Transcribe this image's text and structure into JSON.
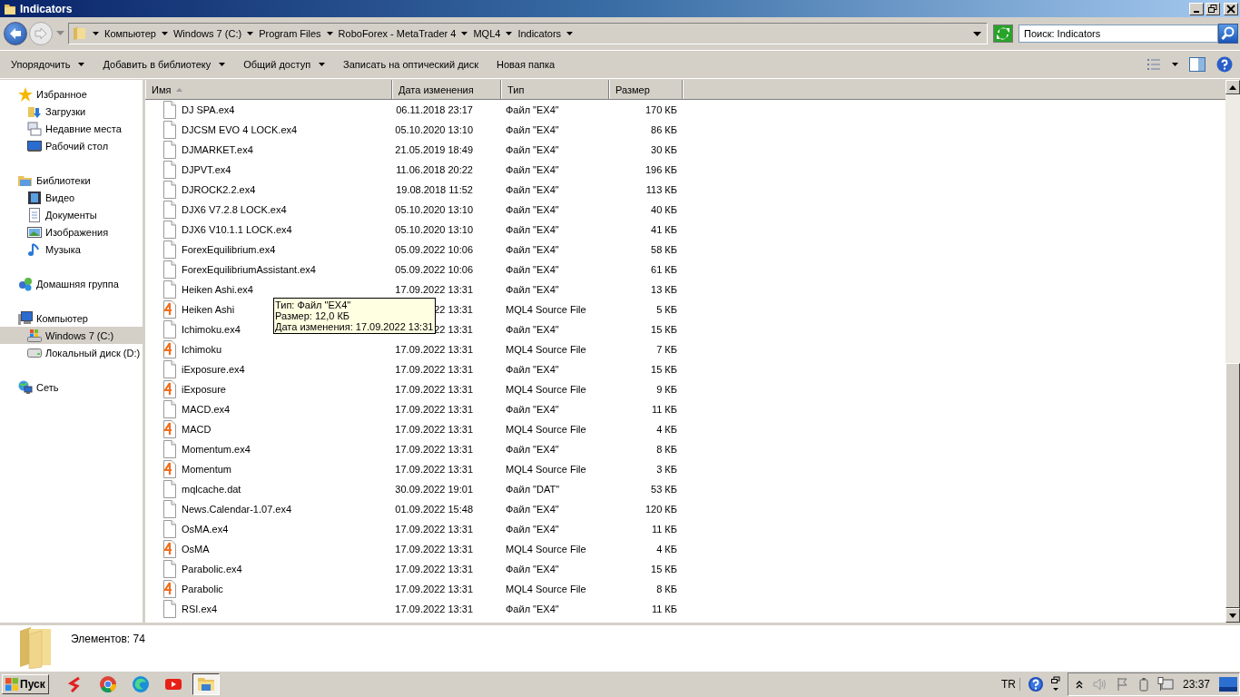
{
  "window": {
    "title": "Indicators"
  },
  "address": {
    "crumbs": [
      "Компьютер",
      "Windows 7 (C:)",
      "Program Files",
      "RoboForex - MetaTrader 4",
      "MQL4",
      "Indicators"
    ],
    "search_placeholder": "Поиск: Indicators"
  },
  "toolbar": [
    {
      "label": "Упорядочить",
      "dropdown": true
    },
    {
      "label": "Добавить в библиотеку",
      "dropdown": true
    },
    {
      "label": "Общий доступ",
      "dropdown": true
    },
    {
      "label": "Записать на оптический диск",
      "dropdown": false
    },
    {
      "label": "Новая папка",
      "dropdown": false
    }
  ],
  "sidebar": [
    {
      "label": "Избранное",
      "selected": false,
      "children": [
        {
          "label": "Загрузки",
          "selected": false
        },
        {
          "label": "Недавние места",
          "selected": false
        },
        {
          "label": "Рабочий стол",
          "selected": false
        }
      ]
    },
    {
      "label": "Библиотеки",
      "selected": false,
      "children": [
        {
          "label": "Видео",
          "selected": false
        },
        {
          "label": "Документы",
          "selected": false
        },
        {
          "label": "Изображения",
          "selected": false
        },
        {
          "label": "Музыка",
          "selected": false
        }
      ]
    },
    {
      "label": "Домашняя группа",
      "selected": false
    },
    {
      "label": "Компьютер",
      "selected": false,
      "children": [
        {
          "label": "Windows 7 (C:)",
          "selected": true
        },
        {
          "label": "Локальный диск (D:)",
          "selected": false
        }
      ]
    },
    {
      "label": "Сеть",
      "selected": false
    }
  ],
  "table": {
    "columns": [
      {
        "label": "Имя",
        "sorted": true
      },
      {
        "label": "Дата изменения",
        "sorted": false
      },
      {
        "label": "Тип",
        "sorted": false
      },
      {
        "label": "Размер",
        "sorted": false
      }
    ],
    "rows": [
      {
        "name": "DJ SPA.ex4",
        "date": "06.11.2018 23:17",
        "type": "Файл \"EX4\"",
        "size": "170 КБ",
        "kind": "blank"
      },
      {
        "name": "DJCSM EVO 4 LOCK.ex4",
        "date": "05.10.2020 13:10",
        "type": "Файл \"EX4\"",
        "size": "86 КБ",
        "kind": "blank"
      },
      {
        "name": "DJMARKET.ex4",
        "date": "21.05.2019 18:49",
        "type": "Файл \"EX4\"",
        "size": "30 КБ",
        "kind": "blank"
      },
      {
        "name": "DJPVT.ex4",
        "date": "11.06.2018 20:22",
        "type": "Файл \"EX4\"",
        "size": "196 КБ",
        "kind": "blank"
      },
      {
        "name": "DJROCK2.2.ex4",
        "date": "19.08.2018 11:52",
        "type": "Файл \"EX4\"",
        "size": "113 КБ",
        "kind": "blank"
      },
      {
        "name": "DJX6 V7.2.8 LOCK.ex4",
        "date": "05.10.2020 13:10",
        "type": "Файл \"EX4\"",
        "size": "40 КБ",
        "kind": "blank"
      },
      {
        "name": "DJX6 V10.1.1 LOCK.ex4",
        "date": "05.10.2020 13:10",
        "type": "Файл \"EX4\"",
        "size": "41 КБ",
        "kind": "blank"
      },
      {
        "name": "ForexEquilibrium.ex4",
        "date": "05.09.2022 10:06",
        "type": "Файл \"EX4\"",
        "size": "58 КБ",
        "kind": "blank"
      },
      {
        "name": "ForexEquilibriumAssistant.ex4",
        "date": "05.09.2022 10:06",
        "type": "Файл \"EX4\"",
        "size": "61 КБ",
        "kind": "blank"
      },
      {
        "name": "Heiken Ashi.ex4",
        "date": "17.09.2022 13:31",
        "type": "Файл \"EX4\"",
        "size": "13 КБ",
        "kind": "blank"
      },
      {
        "name": "Heiken Ashi",
        "date": "22 13:31",
        "type": "MQL4 Source File",
        "size": "5 КБ",
        "kind": "mql4"
      },
      {
        "name": "Ichimoku.ex4",
        "date": "22 13:31",
        "type": "Файл \"EX4\"",
        "size": "15 КБ",
        "kind": "blank"
      },
      {
        "name": "Ichimoku",
        "date": "17.09.2022 13:31",
        "type": "MQL4 Source File",
        "size": "7 КБ",
        "kind": "mql4"
      },
      {
        "name": "iExposure.ex4",
        "date": "17.09.2022 13:31",
        "type": "Файл \"EX4\"",
        "size": "15 КБ",
        "kind": "blank"
      },
      {
        "name": "iExposure",
        "date": "17.09.2022 13:31",
        "type": "MQL4 Source File",
        "size": "9 КБ",
        "kind": "mql4"
      },
      {
        "name": "MACD.ex4",
        "date": "17.09.2022 13:31",
        "type": "Файл \"EX4\"",
        "size": "11 КБ",
        "kind": "blank"
      },
      {
        "name": "MACD",
        "date": "17.09.2022 13:31",
        "type": "MQL4 Source File",
        "size": "4 КБ",
        "kind": "mql4"
      },
      {
        "name": "Momentum.ex4",
        "date": "17.09.2022 13:31",
        "type": "Файл \"EX4\"",
        "size": "8 КБ",
        "kind": "blank"
      },
      {
        "name": "Momentum",
        "date": "17.09.2022 13:31",
        "type": "MQL4 Source File",
        "size": "3 КБ",
        "kind": "mql4"
      },
      {
        "name": "mqlcache.dat",
        "date": "30.09.2022 19:01",
        "type": "Файл \"DAT\"",
        "size": "53 КБ",
        "kind": "blank"
      },
      {
        "name": "News.Calendar-1.07.ex4",
        "date": "01.09.2022 15:48",
        "type": "Файл \"EX4\"",
        "size": "120 КБ",
        "kind": "blank"
      },
      {
        "name": "OsMA.ex4",
        "date": "17.09.2022 13:31",
        "type": "Файл \"EX4\"",
        "size": "11 КБ",
        "kind": "blank"
      },
      {
        "name": "OsMA",
        "date": "17.09.2022 13:31",
        "type": "MQL4 Source File",
        "size": "4 КБ",
        "kind": "mql4"
      },
      {
        "name": "Parabolic.ex4",
        "date": "17.09.2022 13:31",
        "type": "Файл \"EX4\"",
        "size": "15 КБ",
        "kind": "blank"
      },
      {
        "name": "Parabolic",
        "date": "17.09.2022 13:31",
        "type": "MQL4 Source File",
        "size": "8 КБ",
        "kind": "mql4"
      },
      {
        "name": "RSI.ex4",
        "date": "17.09.2022 13:31",
        "type": "Файл \"EX4\"",
        "size": "11 КБ",
        "kind": "blank"
      }
    ]
  },
  "tooltip": [
    "Тип: Файл \"EX4\"",
    "Размер: 12,0 КБ",
    "Дата изменения: 17.09.2022 13:31"
  ],
  "details": {
    "count": "Элементов: 74"
  },
  "taskbar": {
    "start": "Пуск",
    "apps": [
      {
        "kind": "s-app",
        "selected": false
      },
      {
        "kind": "chrome",
        "selected": false
      },
      {
        "kind": "edge",
        "selected": false
      },
      {
        "kind": "youtube",
        "selected": false
      },
      {
        "kind": "explorer",
        "selected": true
      }
    ],
    "language": "TR",
    "time": "23:37"
  }
}
